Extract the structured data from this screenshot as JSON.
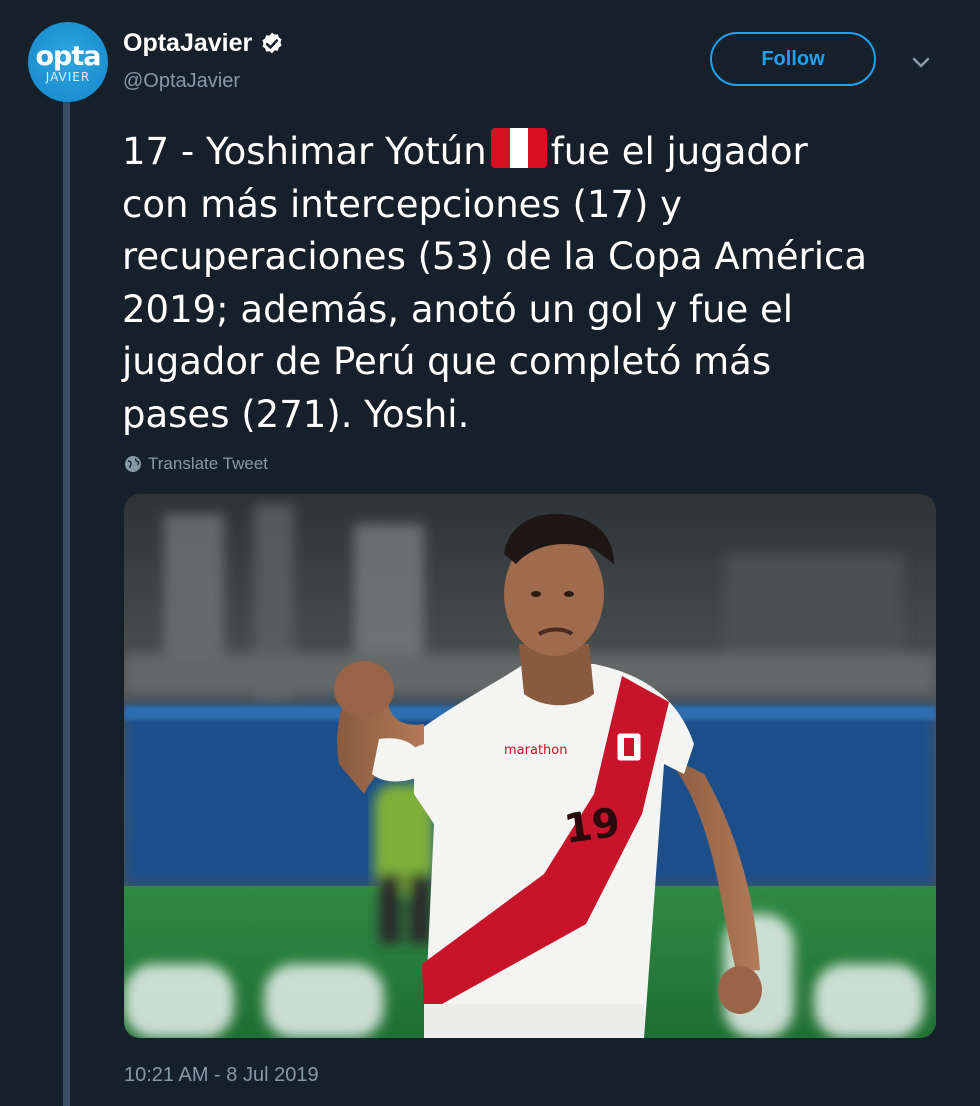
{
  "author": {
    "avatar_text_main": "opta",
    "avatar_text_sub": "JAVIER",
    "display_name": "OptaJavier",
    "handle": "@OptaJavier",
    "verified": true
  },
  "actions": {
    "follow_label": "Follow",
    "more_icon": "chevron-down-icon"
  },
  "tweet": {
    "line1_before_flag": "17 - Yoshimar Yotún",
    "line1_after_flag": "fue el jugador",
    "flag": "peru-flag",
    "lines": [
      "con más intercepciones (17) y",
      "recuperaciones (53) de la Copa América",
      "2019; además, anotó un gol y fue el",
      "jugador de Perú que completó más",
      "pases (271). Yoshi."
    ],
    "translate_label": "Translate Tweet",
    "media_description_icon": "player-photo",
    "jersey_sponsor": "marathon",
    "jersey_number": "19",
    "timestamp": "10:21 AM - 8 Jul 2019"
  },
  "colors": {
    "background": "#15202b",
    "accent": "#1da1f2",
    "secondary_text": "#8899a6",
    "thread_line": "#3a4c63"
  }
}
